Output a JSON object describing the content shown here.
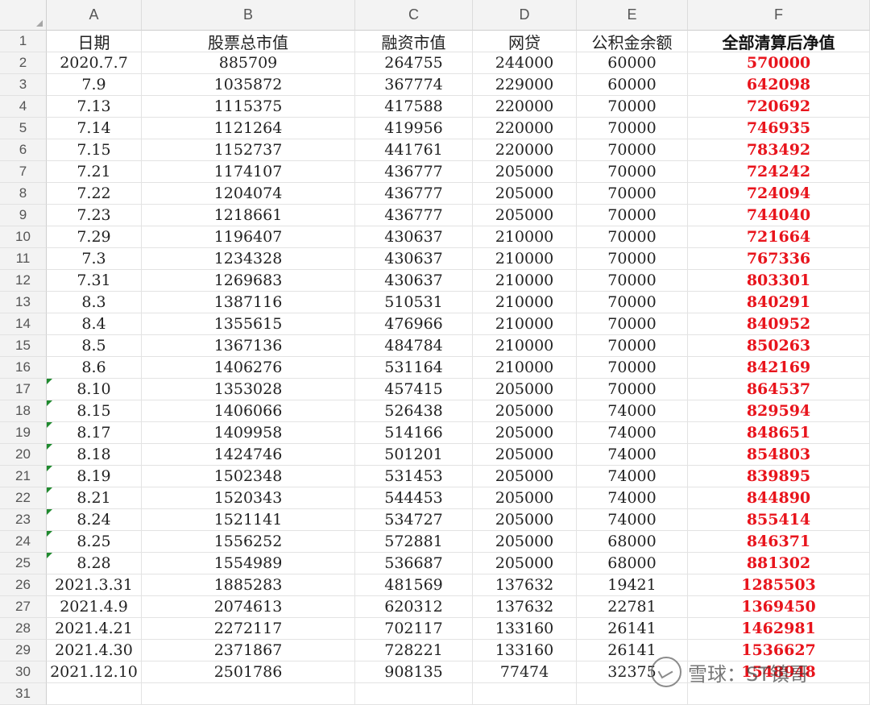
{
  "columns": [
    "A",
    "B",
    "C",
    "D",
    "E",
    "F"
  ],
  "headers": [
    "日期",
    "股票总市值",
    "融资市值",
    "网贷",
    "公积金余额",
    "全部清算后净值"
  ],
  "rows": [
    [
      "2020.7.7",
      "885709",
      "264755",
      "244000",
      "60000",
      "570000"
    ],
    [
      "7.9",
      "1035872",
      "367774",
      "229000",
      "60000",
      "642098"
    ],
    [
      "7.13",
      "1115375",
      "417588",
      "220000",
      "70000",
      "720692"
    ],
    [
      "7.14",
      "1121264",
      "419956",
      "220000",
      "70000",
      "746935"
    ],
    [
      "7.15",
      "1152737",
      "441761",
      "220000",
      "70000",
      "783492"
    ],
    [
      "7.21",
      "1174107",
      "436777",
      "205000",
      "70000",
      "724242"
    ],
    [
      "7.22",
      "1204074",
      "436777",
      "205000",
      "70000",
      "724094"
    ],
    [
      "7.23",
      "1218661",
      "436777",
      "205000",
      "70000",
      "744040"
    ],
    [
      "7.29",
      "1196407",
      "430637",
      "210000",
      "70000",
      "721664"
    ],
    [
      "7.3",
      "1234328",
      "430637",
      "210000",
      "70000",
      "767336"
    ],
    [
      "7.31",
      "1269683",
      "430637",
      "210000",
      "70000",
      "803301"
    ],
    [
      "8.3",
      "1387116",
      "510531",
      "210000",
      "70000",
      "840291"
    ],
    [
      "8.4",
      "1355615",
      "476966",
      "210000",
      "70000",
      "840952"
    ],
    [
      "8.5",
      "1367136",
      "484784",
      "210000",
      "70000",
      "850263"
    ],
    [
      "8.6",
      "1406276",
      "531164",
      "210000",
      "70000",
      "842169"
    ],
    [
      "8.10",
      "1353028",
      "457415",
      "205000",
      "70000",
      "864537"
    ],
    [
      "8.15",
      "1406066",
      "526438",
      "205000",
      "74000",
      "829594"
    ],
    [
      "8.17",
      "1409958",
      "514166",
      "205000",
      "74000",
      "848651"
    ],
    [
      "8.18",
      "1424746",
      "501201",
      "205000",
      "74000",
      "854803"
    ],
    [
      "8.19",
      "1502348",
      "531453",
      "205000",
      "74000",
      "839895"
    ],
    [
      "8.21",
      "1520343",
      "544453",
      "205000",
      "74000",
      "844890"
    ],
    [
      "8.24",
      "1521141",
      "534727",
      "205000",
      "74000",
      "855414"
    ],
    [
      "8.25",
      "1556252",
      "572881",
      "205000",
      "68000",
      "846371"
    ],
    [
      "8.28",
      "1554989",
      "536687",
      "205000",
      "68000",
      "881302"
    ],
    [
      "2021.3.31",
      "1885283",
      "481569",
      "137632",
      "19421",
      "1285503"
    ],
    [
      "2021.4.9",
      "2074613",
      "620312",
      "137632",
      "22781",
      "1369450"
    ],
    [
      "2021.4.21",
      "2272117",
      "702117",
      "133160",
      "26141",
      "1462981"
    ],
    [
      "2021.4.30",
      "2371867",
      "728221",
      "133160",
      "26141",
      "1536627"
    ],
    [
      "2021.12.10",
      "2501786",
      "908135",
      "77474",
      "32375",
      "1548948"
    ]
  ],
  "row_numbers": [
    "1",
    "2",
    "3",
    "4",
    "5",
    "6",
    "7",
    "8",
    "9",
    "10",
    "11",
    "12",
    "13",
    "14",
    "15",
    "16",
    "17",
    "18",
    "19",
    "20",
    "21",
    "22",
    "23",
    "24",
    "25",
    "26",
    "27",
    "28",
    "29",
    "30",
    "31"
  ],
  "flagged_rows": [
    "17",
    "18",
    "19",
    "20",
    "21",
    "22",
    "23",
    "24",
    "25"
  ],
  "colors": {
    "net_value": "#e8141c",
    "flag": "#1f8a2e",
    "header_bg": "#f3f3f3"
  },
  "watermark": {
    "text": "雪球：ST镇哥",
    "icon": "snowball-logo-icon"
  }
}
